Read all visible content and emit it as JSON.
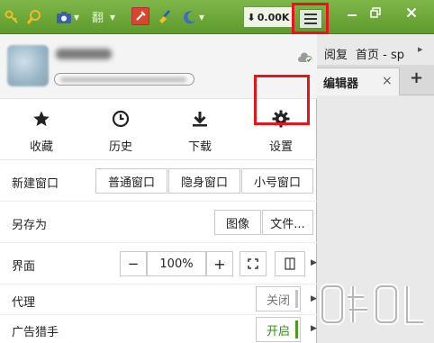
{
  "toolbar": {
    "icons": [
      "key-icon",
      "search-icon",
      "camera-icon",
      "translate-icon",
      "tools-icon",
      "broom-icon",
      "moon-icon"
    ],
    "download_speed": "0.00K",
    "menu_icon": "list-menu-icon",
    "window_controls": [
      "minimize-icon",
      "restore-icon",
      "close-icon"
    ]
  },
  "background": {
    "bookmark_partial": "阅复",
    "bookmark_home": "首页 - sp",
    "tab_title": "编辑器",
    "tab_close": "×",
    "new_tab": "+"
  },
  "profile": {
    "name": "",
    "email": "",
    "sync_icon": "cloud-sync-icon"
  },
  "quick_actions": [
    {
      "label": "收藏",
      "icon": "star-icon"
    },
    {
      "label": "历史",
      "icon": "clock-icon"
    },
    {
      "label": "下载",
      "icon": "download-icon"
    },
    {
      "label": "设置",
      "icon": "gear-icon"
    }
  ],
  "new_window": {
    "label": "新建窗口",
    "options": [
      "普通窗口",
      "隐身窗口",
      "小号窗口"
    ]
  },
  "save_as": {
    "label": "另存为",
    "options": [
      "图像",
      "文件..."
    ]
  },
  "interface": {
    "label": "界面",
    "minus": "−",
    "zoom": "100%",
    "plus": "+",
    "fullscreen_icon": "fullscreen-icon",
    "reader_icon": "reader-mode-icon"
  },
  "proxy": {
    "label": "代理",
    "state": "关闭"
  },
  "adblock": {
    "label": "广告猎手",
    "state": "开启"
  },
  "colors": {
    "toolbar_green": "#6aa837",
    "highlight_red": "#e8141c",
    "toggle_on": "#4a9a1f",
    "toggle_off": "#bdbdbd"
  }
}
